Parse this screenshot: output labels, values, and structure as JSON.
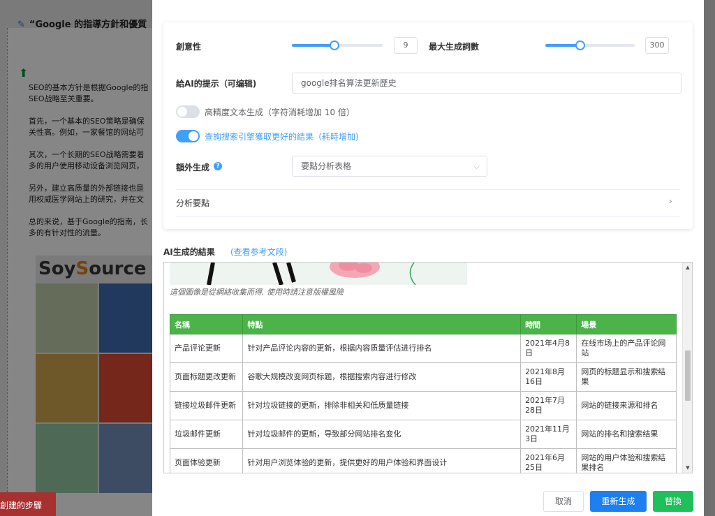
{
  "background": {
    "doc_title": "“Google 的指導方針和優質",
    "paragraphs": [
      "SEO的基本方针是根据Google的指",
      "SEO战略至关重要。",
      "首先，一个基本的SEO策略是确保",
      "关性高。例如，一家餐馆的网站可",
      "其次，一个长期的SEO战略需要着",
      "多的用户使用移动设备浏览网页，",
      "另外，建立高质量的外部链接也是",
      "用权威医学网站上的研究，并在文",
      "总的来说，基于Google的指南，长",
      "多的有针对性的流量。"
    ],
    "ad_logo_a": "Soy",
    "ad_logo_b": "S",
    "ad_logo_c": "ource",
    "red_button": "創建的步驟"
  },
  "settings": {
    "creativity_label": "創意性",
    "creativity_value": "9",
    "creativity_fraction": 0.47,
    "max_words_label": "最大生成詞數",
    "max_words_value": "300",
    "max_words_fraction": 0.39,
    "prompt_label": "給AI的提示（可编辑)",
    "prompt_value": "google排名算法更新歷史",
    "hq_toggle_label": "高精度文本生成（字符消耗增加 10 倍）",
    "hq_toggle_on": false,
    "search_toggle_label": "查詢搜索引擎獲取更好的結果（耗時增加)",
    "search_toggle_on": true,
    "extra_label": "額外生成",
    "extra_select_value": "要點分析表格",
    "analysis_label": "分析要點"
  },
  "result": {
    "label": "AI生成的結果",
    "ref_link": "(查看参考文段)",
    "image_caption": "這個圖像是從網絡收集而得, 使用時請注意版權風險",
    "table": {
      "headers": [
        "名稱",
        "特點",
        "時間",
        "場景"
      ],
      "rows": [
        [
          "产品评论更新",
          "针对产品评论内容的更新，根据内容质量评估进行排名",
          "2021年4月8日",
          "在线市场上的产品评论网站"
        ],
        [
          "页面标题更改更新",
          "谷歌大规模改变网页标题，根据搜索内容进行修改",
          "2021年8月16日",
          "网页的标题显示和搜索结果"
        ],
        [
          "链接垃圾邮件更新",
          "针对垃圾链接的更新，排除非相关和低质量链接",
          "2021年7月28日",
          "网站的链接来源和排名"
        ],
        [
          "垃圾邮件更新",
          "针对垃圾邮件的更新，导致部分网站排名变化",
          "2021年11月3日",
          "网站的排名和搜索结果"
        ],
        [
          "页面体验更新",
          "针对用户浏览体验的更新，提供更好的用户体验和界面设计",
          "2021年6月25日",
          "网站的用户体验和搜索结果排名"
        ]
      ]
    }
  },
  "footer": {
    "cancel": "取消",
    "regenerate": "重新生成",
    "replace": "替換"
  },
  "colors": {
    "accent": "#409eff",
    "table_header": "#4cb34a",
    "regen_button": "#1e7ff0",
    "replace_button": "#1fbf5a"
  }
}
